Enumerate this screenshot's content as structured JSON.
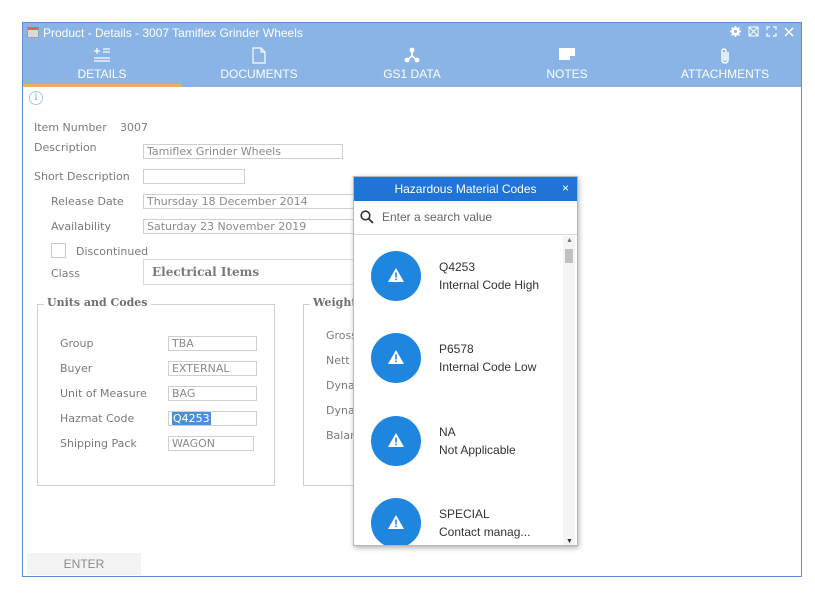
{
  "window": {
    "title": "Product - Details - 3007 Tamiflex Grinder Wheels"
  },
  "tabs": [
    {
      "label": "DETAILS",
      "icon": "details-icon",
      "active": true
    },
    {
      "label": "DOCUMENTS",
      "icon": "document-icon",
      "active": false
    },
    {
      "label": "GS1 DATA",
      "icon": "network-icon",
      "active": false
    },
    {
      "label": "NOTES",
      "icon": "notes-icon",
      "active": false
    },
    {
      "label": "ATTACHMENTS",
      "icon": "paperclip-icon",
      "active": false
    }
  ],
  "form": {
    "item_number_label": "Item Number",
    "item_number_value": "3007",
    "description_label": "Description",
    "description_value": "Tamiflex Grinder Wheels",
    "short_description_label": "Short Description",
    "short_description_value": "",
    "release_date_label": "Release Date",
    "release_date_value": "Thursday 18 December 2014",
    "availability_label": "Availability",
    "availability_value": "Saturday 23 November 2019",
    "discontinued_label": "Discontinued",
    "discontinued_checked": false,
    "class_label": "Class",
    "class_value": "Electrical Items"
  },
  "units": {
    "title": "Units and Codes",
    "group_label": "Group",
    "group_value": "TBA",
    "buyer_label": "Buyer",
    "buyer_value": "EXTERNAL",
    "uom_label": "Unit of Measure",
    "uom_value": "BAG",
    "hazmat_label": "Hazmat Code",
    "hazmat_value": "Q4253",
    "shipping_label": "Shipping Pack",
    "shipping_value": "WAGON"
  },
  "weight": {
    "title": "Weight",
    "labels": [
      "Gross",
      "Nett W",
      "Dyna",
      "Dyna",
      "Balan"
    ]
  },
  "enter_button": "ENTER",
  "popup": {
    "title": "Hazardous Material Codes",
    "close": "×",
    "search_placeholder": "Enter a search value",
    "items": [
      {
        "code": "Q4253",
        "description": "Internal Code High"
      },
      {
        "code": "P6578",
        "description": "Internal Code Low"
      },
      {
        "code": "NA",
        "description": "Not Applicable"
      },
      {
        "code": "SPECIAL",
        "description": "Contact manag..."
      }
    ]
  },
  "colors": {
    "header_bar": "#8ab4e6",
    "active_tab_underline": "#f3a85f",
    "popup_header": "#1f74d6",
    "badge": "#1f86e0",
    "selection": "#4a90d9"
  }
}
